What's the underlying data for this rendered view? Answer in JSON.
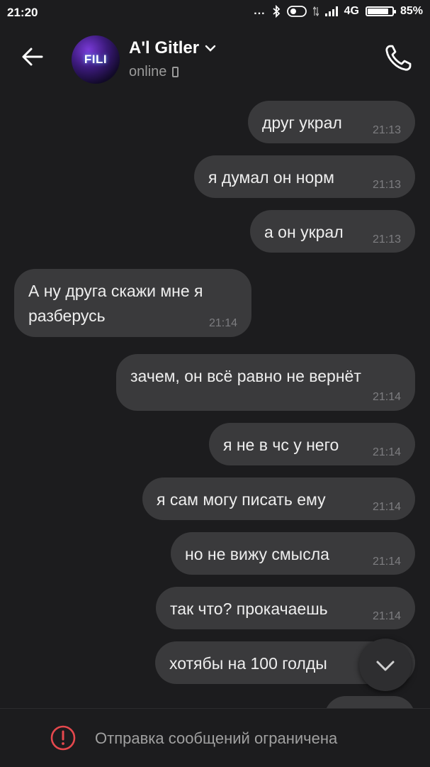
{
  "statusbar": {
    "time": "21:20",
    "dots": "...",
    "network": "4G",
    "battery_percent": "85%",
    "battery_level": 0.85,
    "icons": [
      "bluetooth-icon",
      "toggle-icon",
      "data-arrows-icon",
      "signal-icon",
      "battery-icon"
    ]
  },
  "header": {
    "contact_name": "A'l Gitler",
    "status": "online",
    "avatar_text": "FILI",
    "icons": [
      "back-arrow-icon",
      "chevron-down-icon",
      "mobile-device-icon",
      "phone-call-icon"
    ]
  },
  "messages": [
    {
      "text": "друг украл",
      "time": "21:13",
      "outgoing": true
    },
    {
      "text": "я думал он норм",
      "time": "21:13",
      "outgoing": true
    },
    {
      "text": "а он украл",
      "time": "21:13",
      "outgoing": true
    },
    {
      "text": "А ну друга скажи мне я разберусь",
      "time": "21:14",
      "outgoing": false
    },
    {
      "text": "зачем, он всё равно не вернёт",
      "time": "21:14",
      "outgoing": true
    },
    {
      "text": "я не в чс у него",
      "time": "21:14",
      "outgoing": true
    },
    {
      "text": "я сам могу писать ему",
      "time": "21:14",
      "outgoing": true
    },
    {
      "text": "но не вижу смысла",
      "time": "21:14",
      "outgoing": true
    },
    {
      "text": "так что? прокачаешь",
      "time": "21:14",
      "outgoing": true
    },
    {
      "text": "хотябы на 100 голды",
      "time": "",
      "outgoing": true
    }
  ],
  "composer": {
    "restriction_notice": "Отправка сообщений ограничена",
    "icon": "warning-circle-icon"
  },
  "colors": {
    "background": "#1c1c1e",
    "bubble": "#3a3a3c",
    "warning": "#e5484d"
  }
}
